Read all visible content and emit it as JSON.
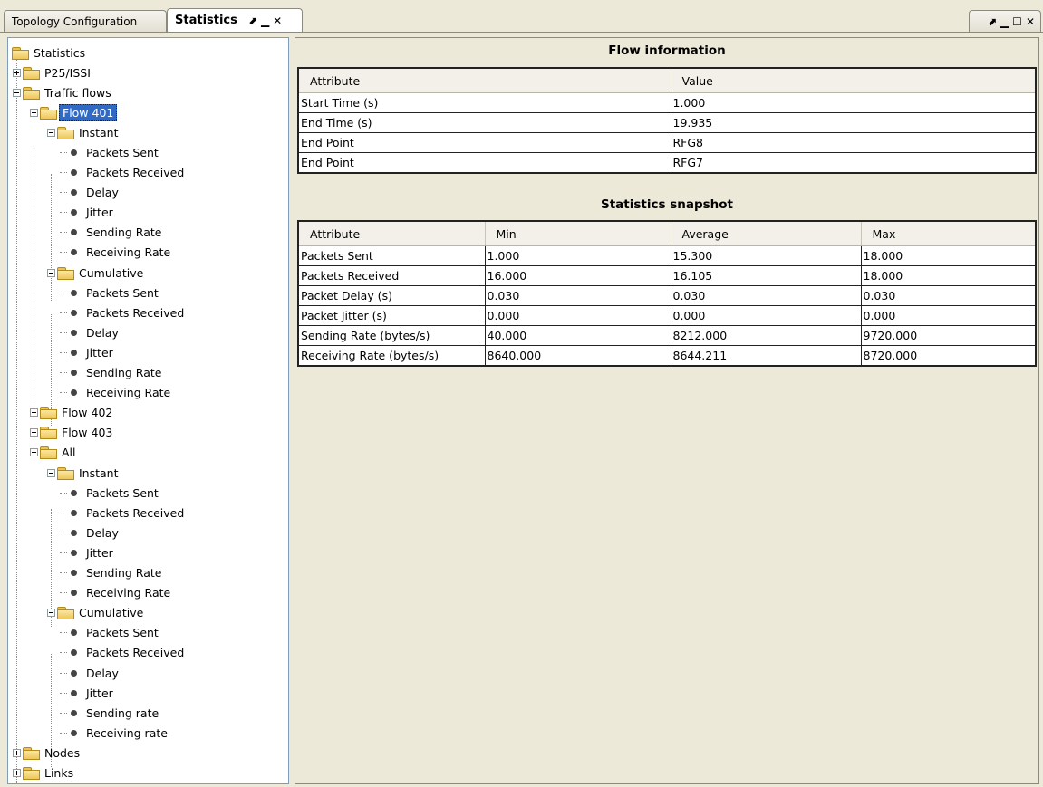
{
  "tabs": [
    {
      "label": "Topology Configuration",
      "active": false
    },
    {
      "label": "Statistics",
      "active": true
    }
  ],
  "tab_controls": {
    "float": "⬈",
    "minimize": "▁",
    "close": "✕"
  },
  "right_controls": {
    "float": "⬈",
    "minimize": "▁",
    "maximize": "☐",
    "close": "✕"
  },
  "tree": {
    "root": "Statistics",
    "nodes": [
      {
        "label": "P25/ISSI",
        "level": 1,
        "type": "folder",
        "expander": "plus"
      },
      {
        "label": "Traffic flows",
        "level": 1,
        "type": "folder",
        "expander": "minus"
      },
      {
        "label": "Flow 401",
        "level": 2,
        "type": "folder",
        "expander": "minus",
        "selected": true
      },
      {
        "label": "Instant",
        "level": 3,
        "type": "folder",
        "expander": "minus"
      },
      {
        "label": "Packets Sent",
        "level": 4,
        "type": "leaf"
      },
      {
        "label": "Packets Received",
        "level": 4,
        "type": "leaf"
      },
      {
        "label": "Delay",
        "level": 4,
        "type": "leaf"
      },
      {
        "label": "Jitter",
        "level": 4,
        "type": "leaf"
      },
      {
        "label": "Sending Rate",
        "level": 4,
        "type": "leaf"
      },
      {
        "label": "Receiving Rate",
        "level": 4,
        "type": "leaf"
      },
      {
        "label": "Cumulative",
        "level": 3,
        "type": "folder",
        "expander": "minus"
      },
      {
        "label": "Packets Sent",
        "level": 4,
        "type": "leaf"
      },
      {
        "label": "Packets Received",
        "level": 4,
        "type": "leaf"
      },
      {
        "label": "Delay",
        "level": 4,
        "type": "leaf"
      },
      {
        "label": "Jitter",
        "level": 4,
        "type": "leaf"
      },
      {
        "label": "Sending Rate",
        "level": 4,
        "type": "leaf"
      },
      {
        "label": "Receiving Rate",
        "level": 4,
        "type": "leaf"
      },
      {
        "label": "Flow 402",
        "level": 2,
        "type": "folder",
        "expander": "plus"
      },
      {
        "label": "Flow 403",
        "level": 2,
        "type": "folder",
        "expander": "plus"
      },
      {
        "label": "All",
        "level": 2,
        "type": "folder",
        "expander": "minus"
      },
      {
        "label": "Instant",
        "level": 3,
        "type": "folder",
        "expander": "minus"
      },
      {
        "label": "Packets Sent",
        "level": 4,
        "type": "leaf"
      },
      {
        "label": "Packets Received",
        "level": 4,
        "type": "leaf"
      },
      {
        "label": "Delay",
        "level": 4,
        "type": "leaf"
      },
      {
        "label": "Jitter",
        "level": 4,
        "type": "leaf"
      },
      {
        "label": "Sending Rate",
        "level": 4,
        "type": "leaf"
      },
      {
        "label": "Receiving Rate",
        "level": 4,
        "type": "leaf"
      },
      {
        "label": "Cumulative",
        "level": 3,
        "type": "folder",
        "expander": "minus"
      },
      {
        "label": "Packets Sent",
        "level": 4,
        "type": "leaf"
      },
      {
        "label": "Packets Received",
        "level": 4,
        "type": "leaf"
      },
      {
        "label": "Delay",
        "level": 4,
        "type": "leaf"
      },
      {
        "label": "Jitter",
        "level": 4,
        "type": "leaf"
      },
      {
        "label": "Sending rate",
        "level": 4,
        "type": "leaf"
      },
      {
        "label": "Receiving rate",
        "level": 4,
        "type": "leaf"
      },
      {
        "label": "Nodes",
        "level": 1,
        "type": "folder",
        "expander": "plus"
      },
      {
        "label": "Links",
        "level": 1,
        "type": "folder",
        "expander": "plus"
      }
    ]
  },
  "flow_info": {
    "title": "Flow information",
    "headers": [
      "Attribute",
      "Value"
    ],
    "rows": [
      [
        "Start Time (s)",
        "1.000"
      ],
      [
        "End Time (s)",
        "19.935"
      ],
      [
        "End Point",
        "RFG8"
      ],
      [
        "End Point",
        "RFG7"
      ]
    ]
  },
  "snapshot": {
    "title": "Statistics snapshot",
    "headers": [
      "Attribute",
      "Min",
      "Average",
      "Max"
    ],
    "rows": [
      [
        "Packets Sent",
        "1.000",
        "15.300",
        "18.000"
      ],
      [
        "Packets Received",
        "16.000",
        "16.105",
        "18.000"
      ],
      [
        "Packet Delay (s)",
        "0.030",
        "0.030",
        "0.030"
      ],
      [
        "Packet Jitter (s)",
        "0.000",
        "0.000",
        "0.000"
      ],
      [
        "Sending Rate (bytes/s)",
        "40.000",
        "8212.000",
        "9720.000"
      ],
      [
        "Receiving Rate (bytes/s)",
        "8640.000",
        "8644.211",
        "8720.000"
      ]
    ]
  }
}
